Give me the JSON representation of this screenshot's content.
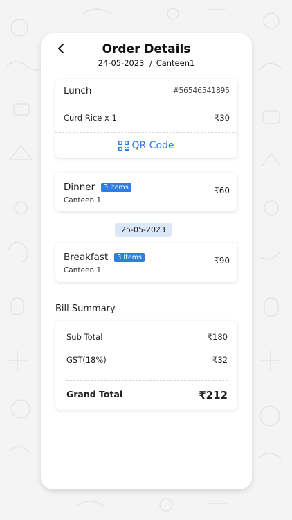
{
  "header": {
    "title": "Order Details",
    "date": "24-05-2023",
    "separator": "/",
    "canteen": "Canteen1"
  },
  "orders": [
    {
      "meal": "Lunch",
      "order_id": "#56546541895",
      "item": "Curd Rice x 1",
      "item_price": "₹30",
      "qr_label": "QR Code"
    },
    {
      "meal": "Dinner",
      "badge": "3 Items",
      "canteen": "Canteen 1",
      "price": "₹60"
    },
    {
      "meal": "Breakfast",
      "badge": "3 Items",
      "canteen": "Canteen 1",
      "price": "₹90"
    }
  ],
  "date_separator": "25-05-2023",
  "bill": {
    "title": "Bill Summary",
    "subtotal_label": "Sub Total",
    "subtotal_value": "₹180",
    "gst_label": "GST(18%)",
    "gst_value": "₹32",
    "grand_label": "Grand Total",
    "grand_value": "₹212"
  },
  "colors": {
    "accent": "#2f7de1",
    "pill_bg": "#dbe8f7",
    "card_bg": "#ffffff",
    "page_bg": "#f4f4f4"
  },
  "icons": {
    "back": "chevron-left-icon",
    "qr": "qr-code-icon"
  }
}
